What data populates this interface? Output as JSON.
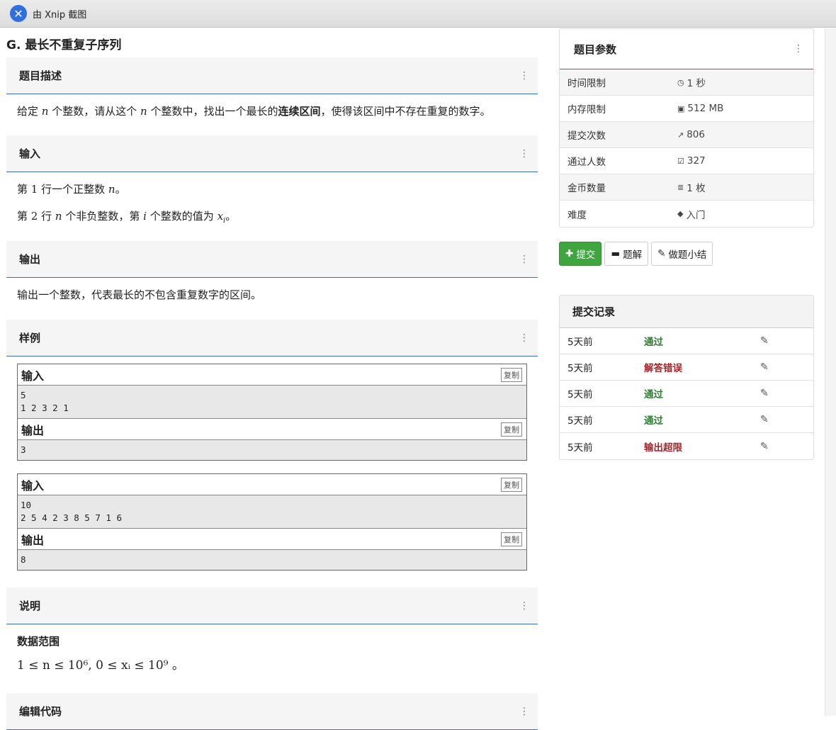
{
  "window": {
    "title": "由 Xnip 截图"
  },
  "problem": {
    "title": "G. 最长不重复子序列",
    "sections": {
      "description": {
        "heading": "题目描述",
        "text_pre": "给定",
        "var_n": "n",
        "text_mid": "个整数，请从这个",
        "var_n2": "n",
        "text_mid2": "个整数中，找出一个最长的",
        "text_bold": "连续区间",
        "text_post": "，使得该区间中不存在重复的数字。"
      },
      "input": {
        "heading": "输入",
        "line1_pre": "第",
        "line1_num": "1",
        "line1_mid": "行一个正整数",
        "line1_var": "n",
        "line1_post": "。",
        "line2_pre": "第",
        "line2_num": "2",
        "line2_mid": "行",
        "line2_var": "n",
        "line2_mid2": "个非负整数，第",
        "line2_var_i": "i",
        "line2_mid3": "个整数的值为",
        "line2_var_x": "x",
        "line2_sub": "i",
        "line2_post": "。"
      },
      "output": {
        "heading": "输出",
        "text": "输出一个整数，代表最长的不包含重复数字的区间。"
      },
      "samples": {
        "heading": "样例",
        "input_label": "输入",
        "output_label": "输出",
        "copy_label": "复制",
        "items": [
          {
            "input": "5\n1 2 3 2 1",
            "output": "3"
          },
          {
            "input": "10\n2 5 4 2 3 8 5 7 1 6",
            "output": "8"
          }
        ]
      },
      "notes": {
        "heading": "说明",
        "subheading": "数据范围",
        "range": "1 ≤ n ≤ 10⁶, 0 ≤ xᵢ ≤ 10⁹ 。"
      },
      "editor": {
        "heading": "编辑代码"
      }
    }
  },
  "params": {
    "heading": "题目参数",
    "rows": [
      {
        "label": "时间限制",
        "icon": "clock-icon",
        "value": "1 秒"
      },
      {
        "label": "内存限制",
        "icon": "save-icon",
        "value": "512 MB"
      },
      {
        "label": "提交次数",
        "icon": "share-icon",
        "value": "806"
      },
      {
        "label": "通过人数",
        "icon": "check-square-icon",
        "value": "327"
      },
      {
        "label": "金币数量",
        "icon": "database-icon",
        "value": "1 枚"
      },
      {
        "label": "难度",
        "icon": "tag-icon",
        "value": "入门"
      }
    ]
  },
  "actions": {
    "submit": "提交",
    "solution": "题解",
    "summary": "做题小结"
  },
  "records": {
    "heading": "提交记录",
    "rows": [
      {
        "time": "5天前",
        "status": "通过",
        "kind": "ok"
      },
      {
        "time": "5天前",
        "status": "解答错误",
        "kind": "bad"
      },
      {
        "time": "5天前",
        "status": "通过",
        "kind": "ok"
      },
      {
        "time": "5天前",
        "status": "通过",
        "kind": "ok"
      },
      {
        "time": "5天前",
        "status": "输出超限",
        "kind": "bad"
      }
    ]
  }
}
